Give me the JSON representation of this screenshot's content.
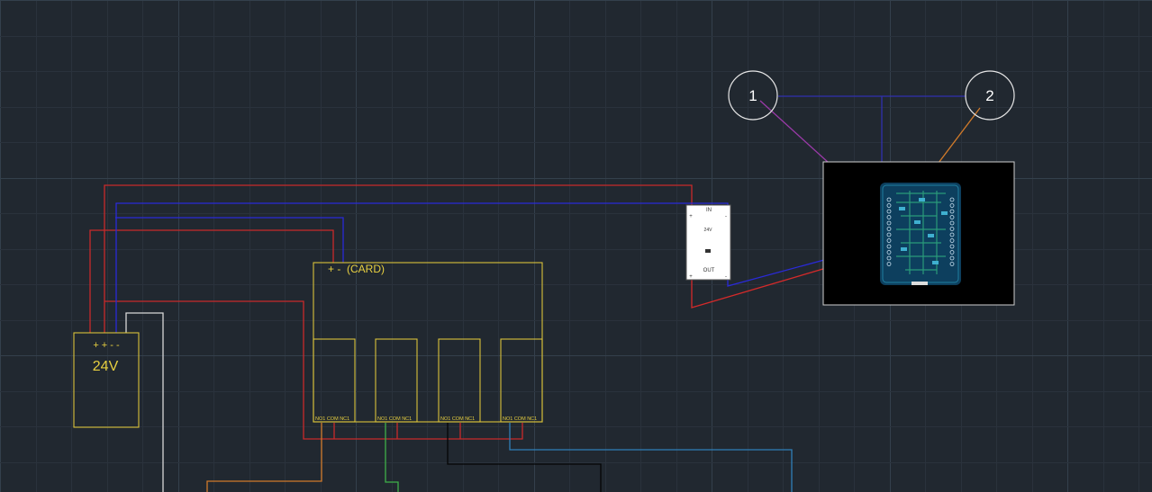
{
  "colors": {
    "background": "#212830",
    "power_red": "#d42a2a",
    "signal_blue": "#2a2ad8",
    "component_yellow": "#d9c23a",
    "white": "#e6e6e6",
    "orange": "#d07a2a",
    "green": "#3fb04a",
    "teal": "#2f7fb8",
    "purple": "#9a3aa8"
  },
  "power_supply": {
    "terminals": "+ + - -",
    "label": "24V"
  },
  "relay_card": {
    "header": "+ -  (CARD)",
    "relays": [
      {
        "pins": "NO1 COM NC1"
      },
      {
        "pins": "NO1 COM NC1"
      },
      {
        "pins": "NO1 COM NC1"
      },
      {
        "pins": "NO1 COM NC1"
      }
    ]
  },
  "converter": {
    "in_label": "IN",
    "plus_in": "+",
    "minus_in": "-",
    "voltage_label": "24V",
    "out_label": "OUT",
    "plus_out": "+",
    "minus_out": "-"
  },
  "callouts": [
    {
      "label": "1"
    },
    {
      "label": "2"
    }
  ],
  "board_image": {
    "icon": "pcb-board-icon"
  }
}
